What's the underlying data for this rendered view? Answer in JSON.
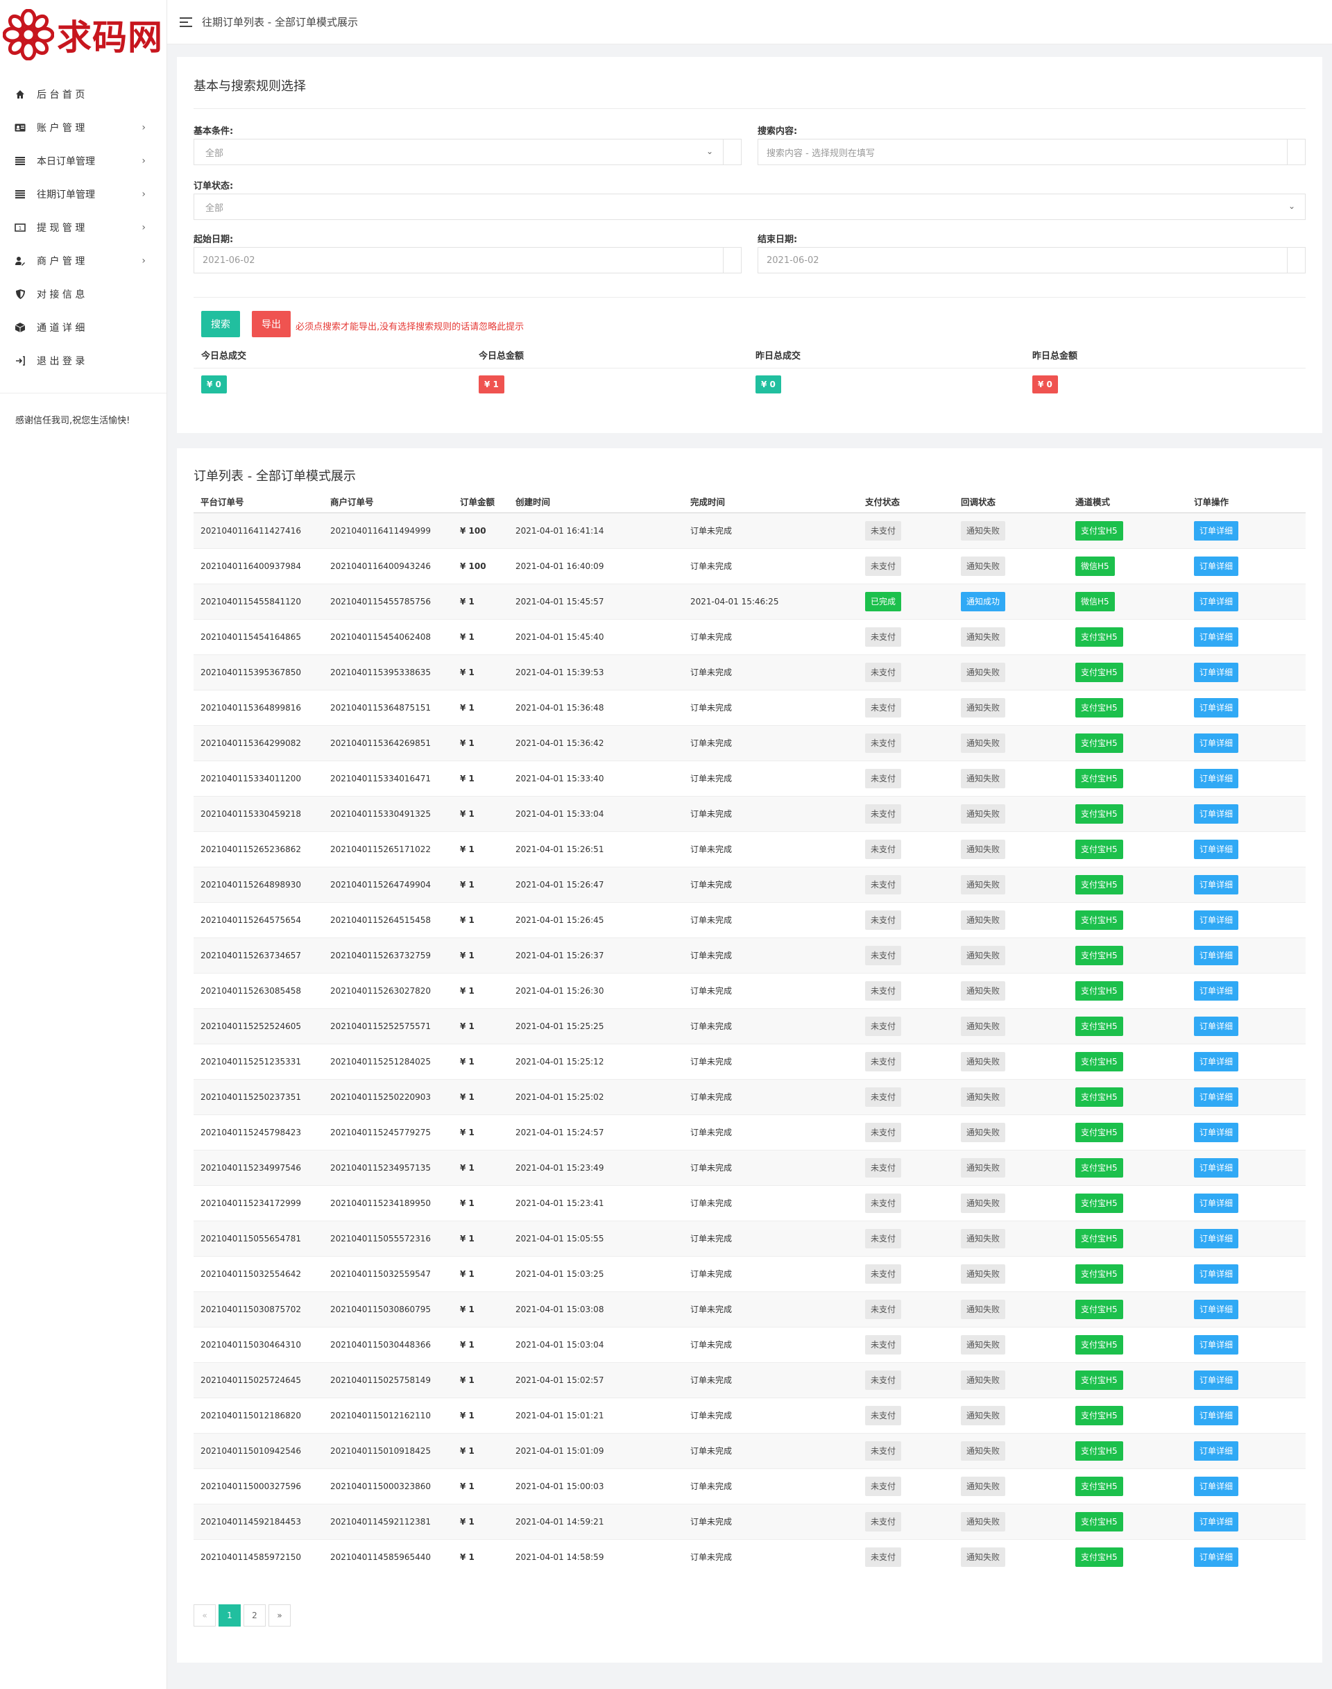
{
  "logo": {
    "text": "求码网",
    "accent": "#c7161e"
  },
  "breadcrumb": "往期订单列表 - 全部订单模式展示",
  "sidebar": {
    "items": [
      {
        "label": "后 台 首 页",
        "icon": "home-icon",
        "has_sub": false
      },
      {
        "label": "账 户 管 理",
        "icon": "id-card-icon",
        "has_sub": true
      },
      {
        "label": "本日订单管理",
        "icon": "list-icon",
        "has_sub": true
      },
      {
        "label": "往期订单管理",
        "icon": "list-icon",
        "has_sub": true
      },
      {
        "label": "提 现 管 理",
        "icon": "cash-icon",
        "has_sub": true
      },
      {
        "label": "商 户 管 理",
        "icon": "user-edit-icon",
        "has_sub": true
      },
      {
        "label": "对 接 信 息",
        "icon": "shield-icon",
        "has_sub": false
      },
      {
        "label": "通 道 详 细",
        "icon": "cube-icon",
        "has_sub": false
      },
      {
        "label": "退 出 登 录",
        "icon": "sign-out-icon",
        "has_sub": false
      }
    ],
    "note": "感谢信任我司,祝您生活愉快!"
  },
  "search": {
    "title": "基本与搜索规则选择",
    "basic_label": "基本条件:",
    "basic_value": "全部",
    "content_label": "搜索内容:",
    "content_placeholder": "搜索内容 - 选择规则在填写",
    "status_label": "订单状态:",
    "status_value": "全部",
    "start_label": "起始日期:",
    "start_value": "2021-06-02",
    "end_label": "结束日期:",
    "end_value": "2021-06-02",
    "search_btn": "搜索",
    "export_btn": "导出",
    "hint": "必须点搜索才能导出,没有选择搜索规则的话请忽略此提示"
  },
  "stats": [
    {
      "label": "今日总成交",
      "value": "¥ 0",
      "color": "teal"
    },
    {
      "label": "今日总金额",
      "value": "¥ 1",
      "color": "red"
    },
    {
      "label": "昨日总成交",
      "value": "¥ 0",
      "color": "teal"
    },
    {
      "label": "昨日总金额",
      "value": "¥ 0",
      "color": "red"
    }
  ],
  "list": {
    "title": "订单列表 - 全部订单模式展示",
    "headers": [
      "平台订单号",
      "商户订单号",
      "订单金额",
      "创建时间",
      "完成时间",
      "支付状态",
      "回调状态",
      "通道模式",
      "订单操作"
    ],
    "action_label": "订单详细",
    "rows": [
      {
        "pid": "2021040116411427416",
        "mid": "2021040116411494999",
        "amt": "¥ 100",
        "created": "2021-04-01 16:41:14",
        "done": "订单未完成",
        "pay": "未支付",
        "cb": "通知失败",
        "ch": "支付宝H5"
      },
      {
        "pid": "2021040116400937984",
        "mid": "2021040116400943246",
        "amt": "¥ 100",
        "created": "2021-04-01 16:40:09",
        "done": "订单未完成",
        "pay": "未支付",
        "cb": "通知失败",
        "ch": "微信H5"
      },
      {
        "pid": "2021040115455841120",
        "mid": "2021040115455785756",
        "amt": "¥ 1",
        "created": "2021-04-01 15:45:57",
        "done": "2021-04-01 15:46:25",
        "pay": "已完成",
        "cb": "通知成功",
        "ch": "微信H5"
      },
      {
        "pid": "2021040115454164865",
        "mid": "2021040115454062408",
        "amt": "¥ 1",
        "created": "2021-04-01 15:45:40",
        "done": "订单未完成",
        "pay": "未支付",
        "cb": "通知失败",
        "ch": "支付宝H5"
      },
      {
        "pid": "2021040115395367850",
        "mid": "2021040115395338635",
        "amt": "¥ 1",
        "created": "2021-04-01 15:39:53",
        "done": "订单未完成",
        "pay": "未支付",
        "cb": "通知失败",
        "ch": "支付宝H5"
      },
      {
        "pid": "2021040115364899816",
        "mid": "2021040115364875151",
        "amt": "¥ 1",
        "created": "2021-04-01 15:36:48",
        "done": "订单未完成",
        "pay": "未支付",
        "cb": "通知失败",
        "ch": "支付宝H5"
      },
      {
        "pid": "2021040115364299082",
        "mid": "2021040115364269851",
        "amt": "¥ 1",
        "created": "2021-04-01 15:36:42",
        "done": "订单未完成",
        "pay": "未支付",
        "cb": "通知失败",
        "ch": "支付宝H5"
      },
      {
        "pid": "2021040115334011200",
        "mid": "2021040115334016471",
        "amt": "¥ 1",
        "created": "2021-04-01 15:33:40",
        "done": "订单未完成",
        "pay": "未支付",
        "cb": "通知失败",
        "ch": "支付宝H5"
      },
      {
        "pid": "2021040115330459218",
        "mid": "2021040115330491325",
        "amt": "¥ 1",
        "created": "2021-04-01 15:33:04",
        "done": "订单未完成",
        "pay": "未支付",
        "cb": "通知失败",
        "ch": "支付宝H5"
      },
      {
        "pid": "2021040115265236862",
        "mid": "2021040115265171022",
        "amt": "¥ 1",
        "created": "2021-04-01 15:26:51",
        "done": "订单未完成",
        "pay": "未支付",
        "cb": "通知失败",
        "ch": "支付宝H5"
      },
      {
        "pid": "2021040115264898930",
        "mid": "2021040115264749904",
        "amt": "¥ 1",
        "created": "2021-04-01 15:26:47",
        "done": "订单未完成",
        "pay": "未支付",
        "cb": "通知失败",
        "ch": "支付宝H5"
      },
      {
        "pid": "2021040115264575654",
        "mid": "2021040115264515458",
        "amt": "¥ 1",
        "created": "2021-04-01 15:26:45",
        "done": "订单未完成",
        "pay": "未支付",
        "cb": "通知失败",
        "ch": "支付宝H5"
      },
      {
        "pid": "2021040115263734657",
        "mid": "2021040115263732759",
        "amt": "¥ 1",
        "created": "2021-04-01 15:26:37",
        "done": "订单未完成",
        "pay": "未支付",
        "cb": "通知失败",
        "ch": "支付宝H5"
      },
      {
        "pid": "2021040115263085458",
        "mid": "2021040115263027820",
        "amt": "¥ 1",
        "created": "2021-04-01 15:26:30",
        "done": "订单未完成",
        "pay": "未支付",
        "cb": "通知失败",
        "ch": "支付宝H5"
      },
      {
        "pid": "2021040115252524605",
        "mid": "2021040115252575571",
        "amt": "¥ 1",
        "created": "2021-04-01 15:25:25",
        "done": "订单未完成",
        "pay": "未支付",
        "cb": "通知失败",
        "ch": "支付宝H5"
      },
      {
        "pid": "2021040115251235331",
        "mid": "2021040115251284025",
        "amt": "¥ 1",
        "created": "2021-04-01 15:25:12",
        "done": "订单未完成",
        "pay": "未支付",
        "cb": "通知失败",
        "ch": "支付宝H5"
      },
      {
        "pid": "2021040115250237351",
        "mid": "2021040115250220903",
        "amt": "¥ 1",
        "created": "2021-04-01 15:25:02",
        "done": "订单未完成",
        "pay": "未支付",
        "cb": "通知失败",
        "ch": "支付宝H5"
      },
      {
        "pid": "2021040115245798423",
        "mid": "2021040115245779275",
        "amt": "¥ 1",
        "created": "2021-04-01 15:24:57",
        "done": "订单未完成",
        "pay": "未支付",
        "cb": "通知失败",
        "ch": "支付宝H5"
      },
      {
        "pid": "2021040115234997546",
        "mid": "2021040115234957135",
        "amt": "¥ 1",
        "created": "2021-04-01 15:23:49",
        "done": "订单未完成",
        "pay": "未支付",
        "cb": "通知失败",
        "ch": "支付宝H5"
      },
      {
        "pid": "2021040115234172999",
        "mid": "2021040115234189950",
        "amt": "¥ 1",
        "created": "2021-04-01 15:23:41",
        "done": "订单未完成",
        "pay": "未支付",
        "cb": "通知失败",
        "ch": "支付宝H5"
      },
      {
        "pid": "2021040115055654781",
        "mid": "2021040115055572316",
        "amt": "¥ 1",
        "created": "2021-04-01 15:05:55",
        "done": "订单未完成",
        "pay": "未支付",
        "cb": "通知失败",
        "ch": "支付宝H5"
      },
      {
        "pid": "2021040115032554642",
        "mid": "2021040115032559547",
        "amt": "¥ 1",
        "created": "2021-04-01 15:03:25",
        "done": "订单未完成",
        "pay": "未支付",
        "cb": "通知失败",
        "ch": "支付宝H5"
      },
      {
        "pid": "2021040115030875702",
        "mid": "2021040115030860795",
        "amt": "¥ 1",
        "created": "2021-04-01 15:03:08",
        "done": "订单未完成",
        "pay": "未支付",
        "cb": "通知失败",
        "ch": "支付宝H5"
      },
      {
        "pid": "2021040115030464310",
        "mid": "2021040115030448366",
        "amt": "¥ 1",
        "created": "2021-04-01 15:03:04",
        "done": "订单未完成",
        "pay": "未支付",
        "cb": "通知失败",
        "ch": "支付宝H5"
      },
      {
        "pid": "2021040115025724645",
        "mid": "2021040115025758149",
        "amt": "¥ 1",
        "created": "2021-04-01 15:02:57",
        "done": "订单未完成",
        "pay": "未支付",
        "cb": "通知失败",
        "ch": "支付宝H5"
      },
      {
        "pid": "2021040115012186820",
        "mid": "2021040115012162110",
        "amt": "¥ 1",
        "created": "2021-04-01 15:01:21",
        "done": "订单未完成",
        "pay": "未支付",
        "cb": "通知失败",
        "ch": "支付宝H5"
      },
      {
        "pid": "2021040115010942546",
        "mid": "2021040115010918425",
        "amt": "¥ 1",
        "created": "2021-04-01 15:01:09",
        "done": "订单未完成",
        "pay": "未支付",
        "cb": "通知失败",
        "ch": "支付宝H5"
      },
      {
        "pid": "2021040115000327596",
        "mid": "2021040115000323860",
        "amt": "¥ 1",
        "created": "2021-04-01 15:00:03",
        "done": "订单未完成",
        "pay": "未支付",
        "cb": "通知失败",
        "ch": "支付宝H5"
      },
      {
        "pid": "2021040114592184453",
        "mid": "2021040114592112381",
        "amt": "¥ 1",
        "created": "2021-04-01 14:59:21",
        "done": "订单未完成",
        "pay": "未支付",
        "cb": "通知失败",
        "ch": "支付宝H5"
      },
      {
        "pid": "2021040114585972150",
        "mid": "2021040114585965440",
        "amt": "¥ 1",
        "created": "2021-04-01 14:58:59",
        "done": "订单未完成",
        "pay": "未支付",
        "cb": "通知失败",
        "ch": "支付宝H5"
      }
    ]
  },
  "pagination": {
    "prev": "«",
    "pages": [
      "1",
      "2"
    ],
    "current": "1",
    "next": "»"
  },
  "colors": {
    "teal": "#21bf9f",
    "red": "#ef5350",
    "green": "#1cc04c",
    "blue": "#30a9f5"
  }
}
